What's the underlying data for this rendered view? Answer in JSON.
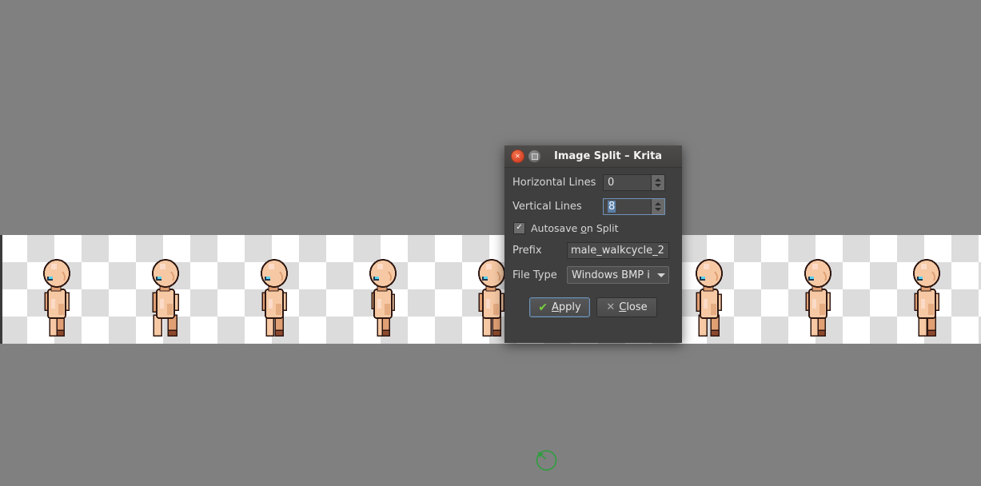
{
  "app": {
    "background_color": "#808080",
    "canvas": {
      "name": "sprite-sheet-canvas",
      "checker_light": "#ffffff",
      "checker_dark": "#dcdcdc",
      "checker_size": 34,
      "sprite_count": 8,
      "sprite_positions": [
        48,
        184,
        320,
        456,
        592,
        864,
        1000,
        1136
      ],
      "description": "male walkcycle sprite sheet with transparency checkerboard"
    },
    "rotate_indicator": {
      "name": "rotate-indicator",
      "color": "#2e9e3e"
    }
  },
  "dialog": {
    "title": "Image Split – Krita",
    "titlebar": {
      "close_icon": "close-icon",
      "maximize_icon": "maximize-icon",
      "close_glyph": "✕"
    },
    "fields": {
      "horizontal_lines": {
        "label": "Horizontal Lines",
        "value": "0",
        "focused": false
      },
      "vertical_lines": {
        "label": "Vertical Lines",
        "value": "8",
        "focused": true,
        "selected": true
      },
      "autosave": {
        "label_pre": "Autosave ",
        "label_mnemonic": "o",
        "label_post": "n Split",
        "checked": true,
        "check_glyph": "✓"
      },
      "prefix": {
        "label": "Prefix",
        "value": "male_walkcycle_2",
        "placeholder": ""
      },
      "file_type": {
        "label": "File Type",
        "value": "Windows BMP i",
        "options": [
          "Windows BMP image"
        ]
      }
    },
    "buttons": {
      "apply": {
        "label_pre": "",
        "label_mnemonic": "A",
        "label_post": "pply",
        "icon": "check-icon",
        "icon_glyph": "✔",
        "focused": true
      },
      "close": {
        "label_pre": "",
        "label_mnemonic": "C",
        "label_post": "lose",
        "icon": "close-x-icon",
        "icon_glyph": "✕",
        "focused": false
      }
    }
  },
  "colors": {
    "dialog_bg": "#3f3f3f",
    "titlebar_bg": "#474544",
    "field_bg": "#4a4a4a",
    "text": "#d6d6d6",
    "accent_focus": "#6f93b8",
    "selection": "#5b7fa6",
    "close_button": "#d9462a",
    "apply_check": "#78d13c"
  }
}
